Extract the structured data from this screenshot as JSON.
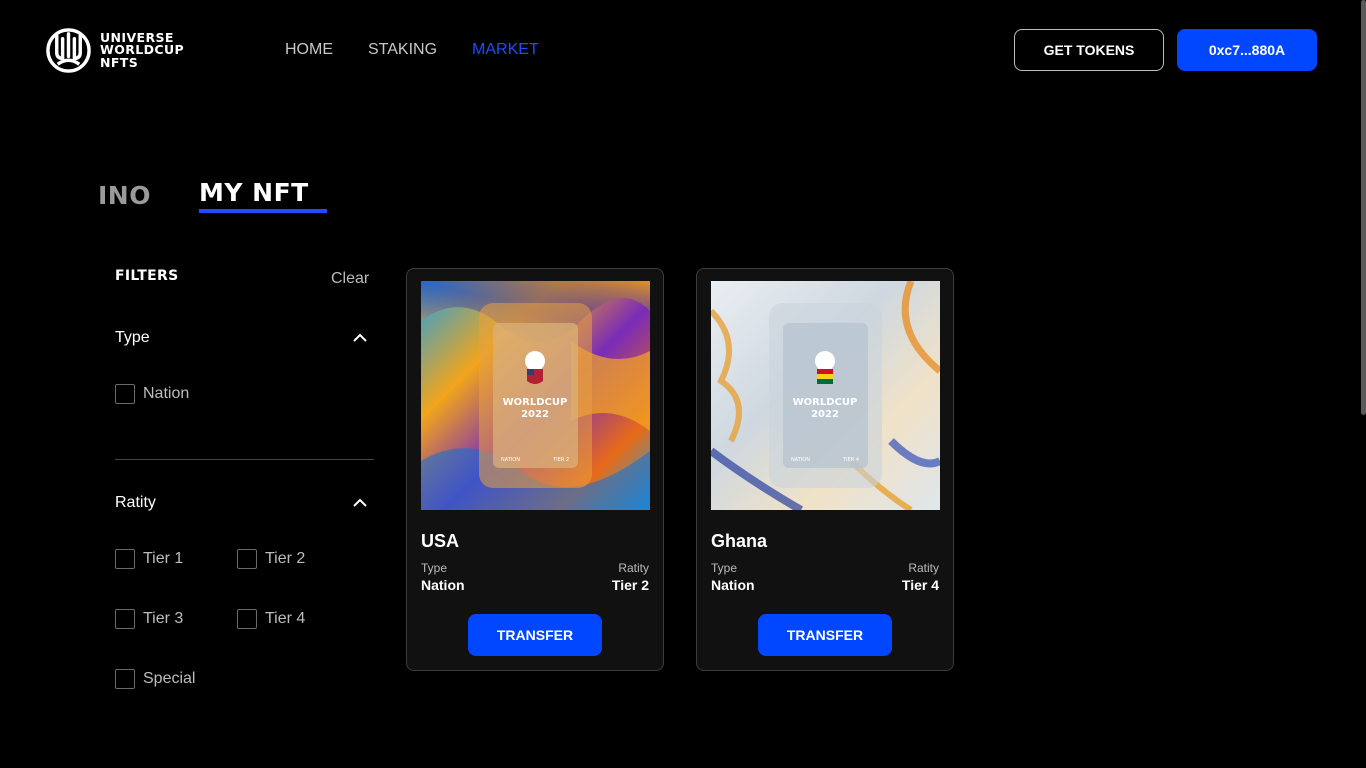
{
  "header": {
    "logo_text": [
      "UNIVERSE",
      "WORLDCUP",
      "NFTS"
    ],
    "nav": [
      {
        "label": "HOME"
      },
      {
        "label": "STAKING"
      },
      {
        "label": "MARKET"
      }
    ],
    "get_tokens_label": "GET TOKENS",
    "wallet_label": "0xc7...880A",
    "active_color": "#1e4dff"
  },
  "tabs": [
    {
      "label": "INO"
    },
    {
      "label": "MY NFT"
    }
  ],
  "filters": {
    "title": "FILTERS",
    "clear_label": "Clear",
    "type": {
      "title": "Type",
      "options": [
        "Nation"
      ]
    },
    "rarity": {
      "title": "Ratity",
      "options": [
        "Tier 1",
        "Tier 2",
        "Tier 3",
        "Tier 4",
        "Special"
      ]
    }
  },
  "cards": [
    {
      "name": "USA",
      "type_label": "Type",
      "type_value": "Nation",
      "rarity_label": "Ratity",
      "rarity_value": "Tier 2",
      "button_label": "TRANSFER",
      "art_title": "WORLDCUP",
      "art_year": "2022",
      "art_left": "NATION",
      "art_right": "TIER 2"
    },
    {
      "name": "Ghana",
      "type_label": "Type",
      "type_value": "Nation",
      "rarity_label": "Ratity",
      "rarity_value": "Tier 4",
      "button_label": "TRANSFER",
      "art_title": "WORLDCUP",
      "art_year": "2022",
      "art_left": "NATION",
      "art_right": "TIER 4"
    }
  ],
  "colors": {
    "accent": "#0047ff",
    "background": "#000000",
    "card_bg": "#111111"
  }
}
